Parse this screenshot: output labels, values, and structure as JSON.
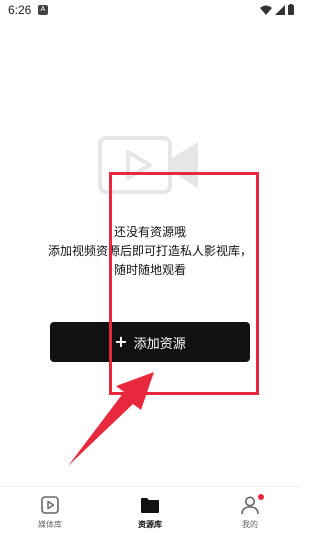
{
  "status_bar": {
    "time": "6:26",
    "notif_glyph": "A"
  },
  "empty_state": {
    "illustration_icon": "video-camera-icon",
    "line1": "还没有资源哦",
    "line2": "添加视频资源后即可打造私人影视库，",
    "line3": "随时随地观看",
    "button_icon": "+",
    "button_label": "添加资源"
  },
  "annotation": {
    "color": "#e8283c"
  },
  "bottom_nav": {
    "items": [
      {
        "label": "媒体库",
        "icon": "play-square-icon",
        "active": false
      },
      {
        "label": "资源库",
        "icon": "folder-icon",
        "active": true
      },
      {
        "label": "我的",
        "icon": "person-icon",
        "active": false,
        "badge": true
      }
    ]
  },
  "colors": {
    "button_bg": "#121212",
    "accent_red": "#e8283c",
    "illustration_gray": "#e6e6e6"
  }
}
